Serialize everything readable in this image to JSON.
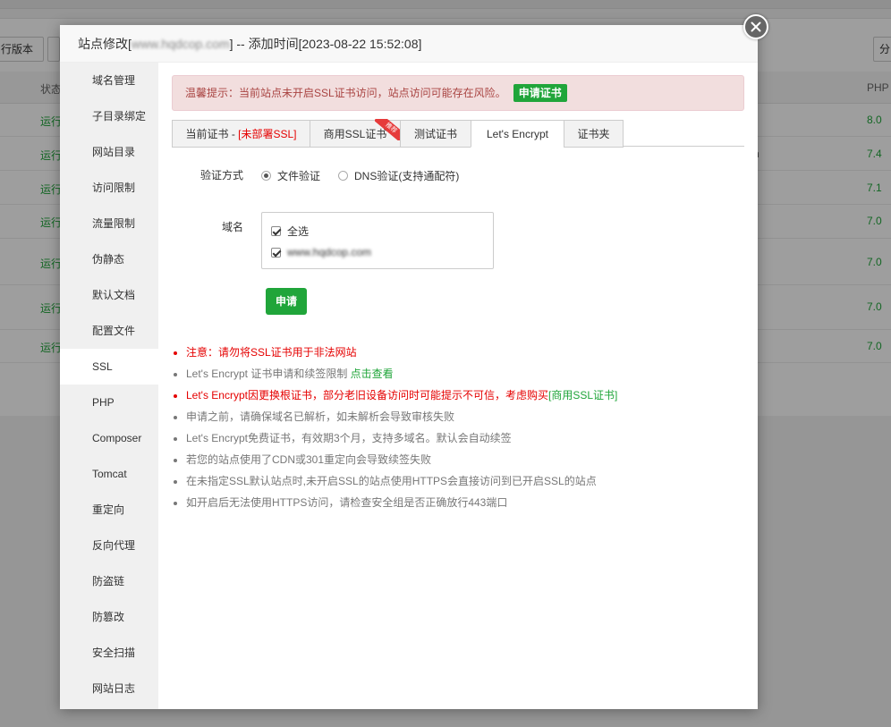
{
  "background": {
    "toolbar_left_btn": "行版本",
    "toolbar_right_btn": "分",
    "header": {
      "status": "状态",
      "php": "PHP"
    },
    "rows": [
      {
        "status": "运行",
        "php": "8.0",
        "extra": ""
      },
      {
        "status": "运行",
        "php": "7.4",
        "extra": "n"
      },
      {
        "status": "运行",
        "php": "7.1",
        "extra": ""
      },
      {
        "status": "运行",
        "php": "7.0",
        "extra": ""
      },
      {
        "status": "运行",
        "php": "7.0",
        "extra": ""
      },
      {
        "status": "运行",
        "php": "7.0",
        "extra": ""
      },
      {
        "status": "运行",
        "php": "7.0",
        "extra": ""
      }
    ]
  },
  "dialog": {
    "title_prefix": "站点修改[",
    "title_domain": "www.hqdcop.com",
    "title_suffix": "] -- 添加时间[2023-08-22 15:52:08]"
  },
  "sidebar": {
    "items": [
      {
        "label": "域名管理"
      },
      {
        "label": "子目录绑定"
      },
      {
        "label": "网站目录"
      },
      {
        "label": "访问限制"
      },
      {
        "label": "流量限制"
      },
      {
        "label": "伪静态"
      },
      {
        "label": "默认文档"
      },
      {
        "label": "配置文件"
      },
      {
        "label": "SSL"
      },
      {
        "label": "PHP"
      },
      {
        "label": "Composer"
      },
      {
        "label": "Tomcat"
      },
      {
        "label": "重定向"
      },
      {
        "label": "反向代理"
      },
      {
        "label": "防盗链"
      },
      {
        "label": "防篡改"
      },
      {
        "label": "安全扫描"
      },
      {
        "label": "网站日志"
      }
    ],
    "active_index": 8
  },
  "alert": {
    "text": "温馨提示：当前站点未开启SSL证书访问，站点访问可能存在风险。",
    "button": "申请证书"
  },
  "tabs": {
    "current_cert": "当前证书 - ",
    "current_cert_status": "[未部署SSL]",
    "commercial": "商用SSL证书",
    "commercial_badge": "推荐",
    "test": "测试证书",
    "letsencrypt": "Let's Encrypt",
    "folder": "证书夹"
  },
  "form": {
    "verify_label": "验证方式",
    "verify_options": [
      "文件验证",
      "DNS验证(支持通配符)"
    ],
    "verify_selected": 0,
    "domain_label": "域名",
    "select_all": "全选",
    "domain_item": "www.hqdcop.com",
    "submit": "申请"
  },
  "tips": {
    "t1": "注意：请勿将SSL证书用于非法网站",
    "t2_text": "Let's Encrypt 证书申请和续签限制 ",
    "t2_link": "点击查看",
    "t3_text": "Let's Encrypt因更换根证书，部分老旧设备访问时可能提示不可信，考虑购买",
    "t3_link": "[商用SSL证书]",
    "t4": "申请之前，请确保域名已解析，如未解析会导致审核失败",
    "t5": "Let's Encrypt免费证书，有效期3个月，支持多域名。默认会自动续签",
    "t6": "若您的站点使用了CDN或301重定向会导致续签失败",
    "t7": "在未指定SSL默认站点时,未开启SSL的站点使用HTTPS会直接访问到已开启SSL的站点",
    "t8": "如开启后无法使用HTTPS访问，请检查安全组是否正确放行443端口"
  },
  "colors": {
    "accent": "#20a53a",
    "danger": "#e50000",
    "alert_bg": "#f2dede",
    "alert_text": "#a94442"
  }
}
